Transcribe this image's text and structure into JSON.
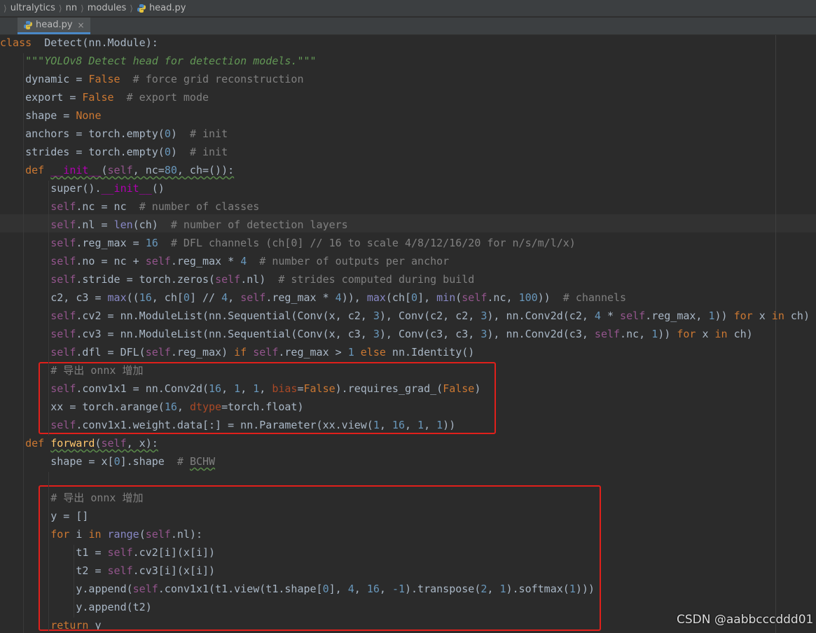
{
  "breadcrumb": {
    "items": [
      "ultralytics",
      "nn",
      "modules",
      "head.py"
    ]
  },
  "tab": {
    "label": "head.py",
    "close_glyph": "×"
  },
  "editor": {
    "lines": [
      [
        [
          "kw",
          "class"
        ],
        [
          "",
          "  Detect(nn.Module):"
        ]
      ],
      [
        [
          "",
          "    "
        ],
        [
          "doc",
          "\"\"\"YOLOv8 Detect head for detection models.\"\"\""
        ]
      ],
      [
        [
          "",
          "    dynamic = "
        ],
        [
          "kw",
          "False"
        ],
        [
          "",
          "  "
        ],
        [
          "cmt",
          "# force grid reconstruction"
        ]
      ],
      [
        [
          "",
          "    export = "
        ],
        [
          "kw",
          "False"
        ],
        [
          "",
          "  "
        ],
        [
          "cmt",
          "# export mode"
        ]
      ],
      [
        [
          "",
          "    shape = "
        ],
        [
          "kw",
          "None"
        ]
      ],
      [
        [
          "",
          "    anchors = torch.empty("
        ],
        [
          "num",
          "0"
        ],
        [
          "",
          ")  "
        ],
        [
          "cmt",
          "# init"
        ]
      ],
      [
        [
          "",
          "    strides = torch.empty("
        ],
        [
          "num",
          "0"
        ],
        [
          "",
          ")  "
        ],
        [
          "cmt",
          "# init"
        ]
      ],
      [
        [
          "",
          "    "
        ],
        [
          "kw",
          "def"
        ],
        [
          "",
          " "
        ],
        [
          "mag wavy",
          "__init__"
        ],
        [
          "wavy",
          "("
        ],
        [
          "self wavy",
          "self"
        ],
        [
          "wavy",
          ", nc="
        ],
        [
          "num wavy",
          "80"
        ],
        [
          "wavy",
          ", ch=()):"
        ]
      ],
      [
        [
          "",
          "        super()."
        ],
        [
          "mag",
          "__init__"
        ],
        [
          "",
          "()"
        ]
      ],
      [
        [
          "",
          "        "
        ],
        [
          "self",
          "self"
        ],
        [
          "",
          ".nc = nc  "
        ],
        [
          "cmt",
          "# number of classes"
        ]
      ],
      [
        [
          "",
          "        "
        ],
        [
          "self",
          "self"
        ],
        [
          "",
          ".nl = "
        ],
        [
          "builtin",
          "len"
        ],
        [
          "",
          "(ch)  "
        ],
        [
          "cmt",
          "# number of detection layers"
        ]
      ],
      [
        [
          "",
          "        "
        ],
        [
          "self",
          "self"
        ],
        [
          "",
          ".reg_max = "
        ],
        [
          "num",
          "16"
        ],
        [
          "",
          "  "
        ],
        [
          "cmt",
          "# DFL channels (ch[0] // 16 to scale 4/8/12/16/20 for n/s/m/l/x)"
        ]
      ],
      [
        [
          "",
          "        "
        ],
        [
          "self",
          "self"
        ],
        [
          "",
          ".no = nc + "
        ],
        [
          "self",
          "self"
        ],
        [
          "",
          ".reg_max * "
        ],
        [
          "num",
          "4"
        ],
        [
          "",
          "  "
        ],
        [
          "cmt",
          "# number of outputs per anchor"
        ]
      ],
      [
        [
          "",
          "        "
        ],
        [
          "self",
          "self"
        ],
        [
          "",
          ".stride = torch.zeros("
        ],
        [
          "self",
          "self"
        ],
        [
          "",
          ".nl)  "
        ],
        [
          "cmt",
          "# strides computed during build"
        ]
      ],
      [
        [
          "",
          "        c2, c3 = "
        ],
        [
          "builtin",
          "max"
        ],
        [
          "",
          "(("
        ],
        [
          "num",
          "16"
        ],
        [
          "",
          ", ch["
        ],
        [
          "num",
          "0"
        ],
        [
          "",
          "] // "
        ],
        [
          "num",
          "4"
        ],
        [
          "",
          ", "
        ],
        [
          "self",
          "self"
        ],
        [
          "",
          ".reg_max * "
        ],
        [
          "num",
          "4"
        ],
        [
          "",
          ")), "
        ],
        [
          "builtin",
          "max"
        ],
        [
          "",
          "(ch["
        ],
        [
          "num",
          "0"
        ],
        [
          "",
          "], "
        ],
        [
          "builtin",
          "min"
        ],
        [
          "",
          "("
        ],
        [
          "self",
          "self"
        ],
        [
          "",
          ".nc, "
        ],
        [
          "num",
          "100"
        ],
        [
          "",
          "))  "
        ],
        [
          "cmt",
          "# channels"
        ]
      ],
      [
        [
          "",
          "        "
        ],
        [
          "self",
          "self"
        ],
        [
          "",
          ".cv2 = nn.ModuleList(nn.Sequential(Conv(x, c2, "
        ],
        [
          "num",
          "3"
        ],
        [
          "",
          "), Conv(c2, c2, "
        ],
        [
          "num",
          "3"
        ],
        [
          "",
          "), nn.Conv2d(c2, "
        ],
        [
          "num",
          "4"
        ],
        [
          "",
          " * "
        ],
        [
          "self",
          "self"
        ],
        [
          "",
          ".reg_max, "
        ],
        [
          "num",
          "1"
        ],
        [
          "",
          ")) "
        ],
        [
          "kw",
          "for"
        ],
        [
          "",
          " x "
        ],
        [
          "kw",
          "in"
        ],
        [
          "",
          " ch)"
        ]
      ],
      [
        [
          "",
          "        "
        ],
        [
          "self",
          "self"
        ],
        [
          "",
          ".cv3 = nn.ModuleList(nn.Sequential(Conv(x, c3, "
        ],
        [
          "num",
          "3"
        ],
        [
          "",
          "), Conv(c3, c3, "
        ],
        [
          "num",
          "3"
        ],
        [
          "",
          "), nn.Conv2d(c3, "
        ],
        [
          "self",
          "self"
        ],
        [
          "",
          ".nc, "
        ],
        [
          "num",
          "1"
        ],
        [
          "",
          ")) "
        ],
        [
          "kw",
          "for"
        ],
        [
          "",
          " x "
        ],
        [
          "kw",
          "in"
        ],
        [
          "",
          " ch)"
        ]
      ],
      [
        [
          "",
          "        "
        ],
        [
          "self",
          "self"
        ],
        [
          "",
          ".dfl = DFL("
        ],
        [
          "self",
          "self"
        ],
        [
          "",
          ".reg_max) "
        ],
        [
          "kw",
          "if"
        ],
        [
          "",
          " "
        ],
        [
          "self",
          "self"
        ],
        [
          "",
          ".reg_max > "
        ],
        [
          "num",
          "1"
        ],
        [
          "",
          " "
        ],
        [
          "kw",
          "else"
        ],
        [
          "",
          " nn.Identity()"
        ]
      ],
      [
        [
          "",
          "        "
        ],
        [
          "cmt",
          "# 导出 onnx 增加"
        ]
      ],
      [
        [
          "",
          "        "
        ],
        [
          "self",
          "self"
        ],
        [
          "",
          ".conv1x1 = nn.Conv2d("
        ],
        [
          "num",
          "16"
        ],
        [
          "",
          ", "
        ],
        [
          "num",
          "1"
        ],
        [
          "",
          ", "
        ],
        [
          "num",
          "1"
        ],
        [
          "",
          ", "
        ],
        [
          "param",
          "bias"
        ],
        [
          "",
          "="
        ],
        [
          "kw",
          "False"
        ],
        [
          "",
          ").requires_grad_("
        ],
        [
          "kw",
          "False"
        ],
        [
          "",
          ")"
        ]
      ],
      [
        [
          "",
          "        xx = torch.arange("
        ],
        [
          "num",
          "16"
        ],
        [
          "",
          ", "
        ],
        [
          "param",
          "dtype"
        ],
        [
          "",
          "=torch.float)"
        ]
      ],
      [
        [
          "",
          "        "
        ],
        [
          "self",
          "self"
        ],
        [
          "",
          ".conv1x1.weight.data[:] = nn.Parameter(xx.view("
        ],
        [
          "num",
          "1"
        ],
        [
          "",
          ", "
        ],
        [
          "num",
          "16"
        ],
        [
          "",
          ", "
        ],
        [
          "num",
          "1"
        ],
        [
          "",
          ", "
        ],
        [
          "num",
          "1"
        ],
        [
          "",
          "))"
        ]
      ],
      [
        [
          "",
          "    "
        ],
        [
          "kw",
          "def"
        ],
        [
          "",
          " "
        ],
        [
          "func wavy",
          "forward"
        ],
        [
          "wavy",
          "("
        ],
        [
          "self wavy",
          "self"
        ],
        [
          "wavy",
          ", x):"
        ]
      ],
      [
        [
          "",
          "        shape = x["
        ],
        [
          "num",
          "0"
        ],
        [
          "",
          "].shape  "
        ],
        [
          "cmt",
          "# "
        ],
        [
          "cmt wavy",
          "BCHW"
        ]
      ],
      [
        [
          "",
          ""
        ]
      ],
      [
        [
          "",
          "        "
        ],
        [
          "cmt",
          "# 导出 onnx 增加"
        ]
      ],
      [
        [
          "",
          "        y = []"
        ]
      ],
      [
        [
          "",
          "        "
        ],
        [
          "kw",
          "for"
        ],
        [
          "",
          " i "
        ],
        [
          "kw",
          "in"
        ],
        [
          "",
          " "
        ],
        [
          "builtin",
          "range"
        ],
        [
          "",
          "("
        ],
        [
          "self",
          "self"
        ],
        [
          "",
          ".nl):"
        ]
      ],
      [
        [
          "",
          "            t1 = "
        ],
        [
          "self",
          "self"
        ],
        [
          "",
          ".cv2[i](x[i])"
        ]
      ],
      [
        [
          "",
          "            t2 = "
        ],
        [
          "self",
          "self"
        ],
        [
          "",
          ".cv3[i](x[i])"
        ]
      ],
      [
        [
          "",
          "            y.append("
        ],
        [
          "self",
          "self"
        ],
        [
          "",
          ".conv1x1(t1.view(t1.shape["
        ],
        [
          "num",
          "0"
        ],
        [
          "",
          "], "
        ],
        [
          "num",
          "4"
        ],
        [
          "",
          ", "
        ],
        [
          "num",
          "16"
        ],
        [
          "",
          ", "
        ],
        [
          "num",
          "-1"
        ],
        [
          "",
          ").transpose("
        ],
        [
          "num",
          "2"
        ],
        [
          "",
          ", "
        ],
        [
          "num",
          "1"
        ],
        [
          "",
          ").softmax("
        ],
        [
          "num",
          "1"
        ],
        [
          "",
          ")))"
        ]
      ],
      [
        [
          "",
          "            y.append(t2)"
        ]
      ],
      [
        [
          "",
          "        "
        ],
        [
          "kw",
          "return"
        ],
        [
          "",
          " y"
        ]
      ]
    ]
  },
  "watermark": "CSDN @aabbcccddd01",
  "colors": {
    "background": "#2b2b2b",
    "highlight_box": "#e0201b",
    "keyword": "#cc7832",
    "self": "#94558d",
    "number": "#6897bb",
    "comment": "#808080",
    "docstring": "#629755"
  }
}
